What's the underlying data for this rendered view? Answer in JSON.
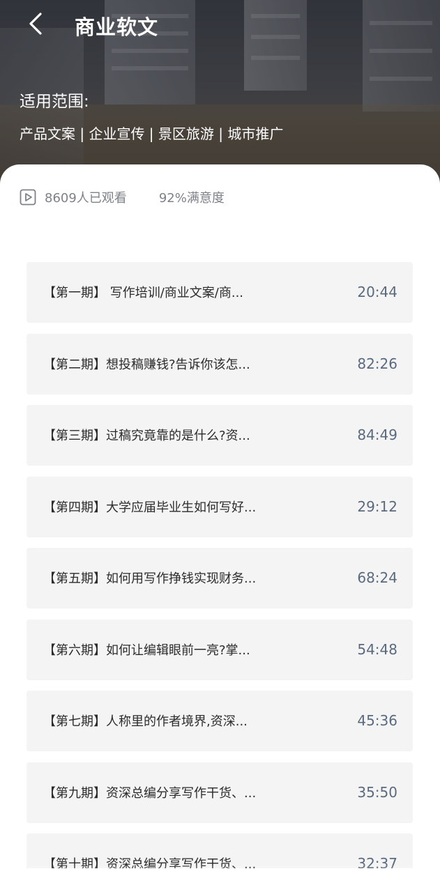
{
  "header": {
    "title": "商业软文",
    "back_icon": "chevron-left-icon"
  },
  "scope": {
    "label": "适用范围:",
    "tags": "产品文案 | 企业宣传 | 景区旅游 | 城市推广"
  },
  "stats": {
    "icon": "video-play-icon",
    "views": "8609人已观看",
    "satisfaction": "92%满意度"
  },
  "episodes": [
    {
      "title": "【第一期】 写作培训/商业文案/商...",
      "duration": "20:44"
    },
    {
      "title": "【第二期】想投稿赚钱?告诉你该怎...",
      "duration": "82:26"
    },
    {
      "title": "【第三期】过稿究竟靠的是什么?资...",
      "duration": "84:49"
    },
    {
      "title": "【第四期】大学应届毕业生如何写好...",
      "duration": "29:12"
    },
    {
      "title": "【第五期】如何用写作挣钱实现财务...",
      "duration": "68:24"
    },
    {
      "title": "【第六期】如何让编辑眼前一亮?掌...",
      "duration": "54:48"
    },
    {
      "title": "【第七期】人称里的作者境界,资深...",
      "duration": "45:36"
    },
    {
      "title": "【第九期】资深总编分享写作干货、...",
      "duration": "35:50"
    },
    {
      "title": "【第十期】资深总编分享写作干货、...",
      "duration": "32:37"
    }
  ],
  "colors": {
    "card_bg": "#ffffff",
    "item_bg": "#f4f4f4",
    "duration_text": "#5a6a7e",
    "muted_text": "#7d8188"
  }
}
